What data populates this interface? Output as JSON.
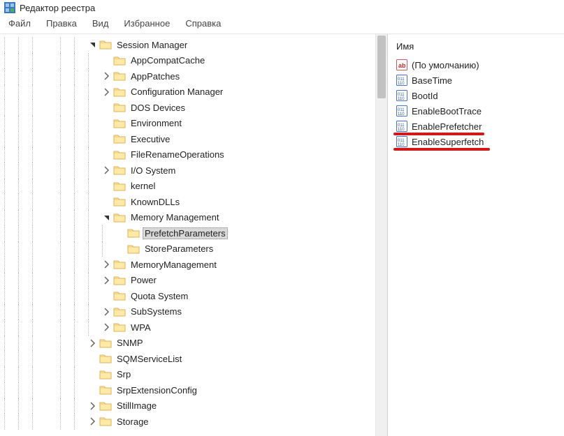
{
  "window": {
    "title": "Редактор реестра"
  },
  "menu": {
    "file": "Файл",
    "edit": "Правка",
    "view": "Вид",
    "favorites": "Избранное",
    "help": "Справка"
  },
  "values_header": "Имя",
  "values": [
    {
      "name": "(По умолчанию)",
      "type": "string"
    },
    {
      "name": "BaseTime",
      "type": "dword"
    },
    {
      "name": "BootId",
      "type": "dword"
    },
    {
      "name": "EnableBootTrace",
      "type": "dword"
    },
    {
      "name": "EnablePrefetcher",
      "type": "dword",
      "underline": true,
      "uw": 130
    },
    {
      "name": "EnableSuperfetch",
      "type": "dword",
      "underline": true,
      "uw": 138
    }
  ],
  "tree": [
    {
      "indent": [
        "l",
        "l",
        "l",
        "b",
        "l",
        "l"
      ],
      "exp": "open",
      "label": "Session Manager"
    },
    {
      "indent": [
        "l",
        "l",
        "l",
        "b",
        "l",
        "l",
        "l"
      ],
      "exp": "none",
      "label": "AppCompatCache"
    },
    {
      "indent": [
        "l",
        "l",
        "l",
        "b",
        "l",
        "l",
        "l"
      ],
      "exp": "closed",
      "label": "AppPatches"
    },
    {
      "indent": [
        "l",
        "l",
        "l",
        "b",
        "l",
        "l",
        "l"
      ],
      "exp": "closed",
      "label": "Configuration Manager"
    },
    {
      "indent": [
        "l",
        "l",
        "l",
        "b",
        "l",
        "l",
        "l"
      ],
      "exp": "none",
      "label": "DOS Devices"
    },
    {
      "indent": [
        "l",
        "l",
        "l",
        "b",
        "l",
        "l",
        "l"
      ],
      "exp": "none",
      "label": "Environment"
    },
    {
      "indent": [
        "l",
        "l",
        "l",
        "b",
        "l",
        "l",
        "l"
      ],
      "exp": "none",
      "label": "Executive"
    },
    {
      "indent": [
        "l",
        "l",
        "l",
        "b",
        "l",
        "l",
        "l"
      ],
      "exp": "none",
      "label": "FileRenameOperations"
    },
    {
      "indent": [
        "l",
        "l",
        "l",
        "b",
        "l",
        "l",
        "l"
      ],
      "exp": "closed",
      "label": "I/O System"
    },
    {
      "indent": [
        "l",
        "l",
        "l",
        "b",
        "l",
        "l",
        "l"
      ],
      "exp": "none",
      "label": "kernel"
    },
    {
      "indent": [
        "l",
        "l",
        "l",
        "b",
        "l",
        "l",
        "l"
      ],
      "exp": "none",
      "label": "KnownDLLs"
    },
    {
      "indent": [
        "l",
        "l",
        "l",
        "b",
        "l",
        "l",
        "l"
      ],
      "exp": "open",
      "label": "Memory Management"
    },
    {
      "indent": [
        "l",
        "l",
        "l",
        "b",
        "l",
        "l",
        "l",
        "l"
      ],
      "exp": "none",
      "label": "PrefetchParameters",
      "selected": true
    },
    {
      "indent": [
        "l",
        "l",
        "l",
        "b",
        "l",
        "l",
        "l",
        "l"
      ],
      "exp": "none",
      "label": "StoreParameters"
    },
    {
      "indent": [
        "l",
        "l",
        "l",
        "b",
        "l",
        "l",
        "l"
      ],
      "exp": "closed",
      "label": "MemoryManagement"
    },
    {
      "indent": [
        "l",
        "l",
        "l",
        "b",
        "l",
        "l",
        "l"
      ],
      "exp": "closed",
      "label": "Power"
    },
    {
      "indent": [
        "l",
        "l",
        "l",
        "b",
        "l",
        "l",
        "l"
      ],
      "exp": "none",
      "label": "Quota System"
    },
    {
      "indent": [
        "l",
        "l",
        "l",
        "b",
        "l",
        "l",
        "l"
      ],
      "exp": "closed",
      "label": "SubSystems"
    },
    {
      "indent": [
        "l",
        "l",
        "l",
        "b",
        "l",
        "l",
        "l"
      ],
      "exp": "closed",
      "label": "WPA"
    },
    {
      "indent": [
        "l",
        "l",
        "l",
        "b",
        "l",
        "l"
      ],
      "exp": "closed",
      "label": "SNMP"
    },
    {
      "indent": [
        "l",
        "l",
        "l",
        "b",
        "l",
        "l"
      ],
      "exp": "none",
      "label": "SQMServiceList"
    },
    {
      "indent": [
        "l",
        "l",
        "l",
        "b",
        "l",
        "l"
      ],
      "exp": "none",
      "label": "Srp"
    },
    {
      "indent": [
        "l",
        "l",
        "l",
        "b",
        "l",
        "l"
      ],
      "exp": "none",
      "label": "SrpExtensionConfig"
    },
    {
      "indent": [
        "l",
        "l",
        "l",
        "b",
        "l",
        "l"
      ],
      "exp": "closed",
      "label": "StillImage"
    },
    {
      "indent": [
        "l",
        "l",
        "l",
        "b",
        "l",
        "l"
      ],
      "exp": "closed",
      "label": "Storage"
    }
  ]
}
